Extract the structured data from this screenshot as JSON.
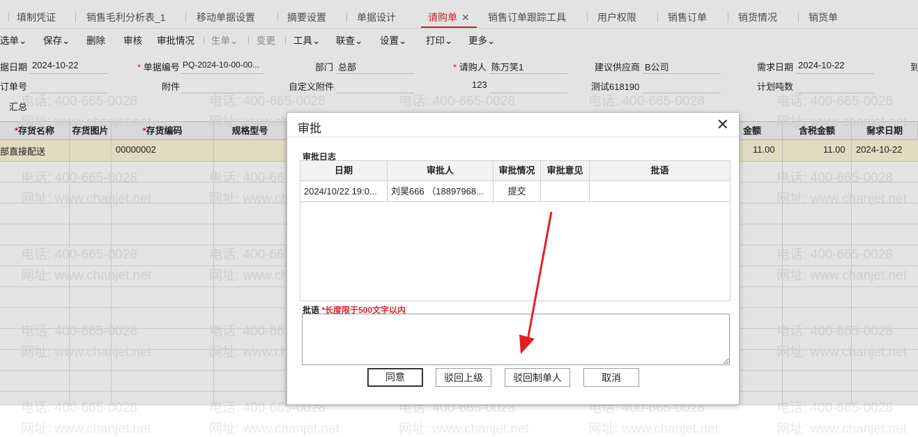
{
  "tabs": [
    "填制凭证",
    "销售毛利分析表_1",
    "移动单据设置",
    "摘要设置",
    "单据设计",
    "请购单",
    "销售订单跟踪工具",
    "用户权限",
    "销售订单",
    "销货情况",
    "销货单"
  ],
  "active_tab_close": "✕",
  "toolbar": {
    "select": "选单",
    "save": "保存",
    "delete": "删除",
    "audit": "审核",
    "audit_status": "审批情况",
    "generate": "生单",
    "change": "变更",
    "tools": "工具",
    "linked_query": "联查",
    "settings": "设置",
    "print": "打印",
    "more": "更多"
  },
  "form": {
    "doc_date_label": "据日期",
    "doc_date_value": "2024-10-22",
    "doc_no_label": "单据编号",
    "doc_no_value": "PQ-2024-10-00-00...",
    "dept_label": "部门",
    "dept_value": "总部",
    "requester_label": "请购人",
    "requester_value": "陈万笑1",
    "supplier_label": "建议供应商",
    "supplier_value": "B公司",
    "need_date_label": "需求日期",
    "need_date_value": "2024-10-22",
    "to_label": "到",
    "order_no_label": "订单号",
    "attach_label": "附件",
    "custom_attach_label": "自定义附件",
    "custom_value": "123",
    "test_label": "测试618190",
    "plan_ton_label": "计划吨数",
    "summary_label": "汇总",
    "required_mark": "*"
  },
  "grid": {
    "headers": [
      "存货名称",
      "存货图片",
      "存货编码",
      "规格型号",
      "金额",
      "含税金额",
      "需求日期"
    ],
    "row": {
      "name": "部直接配送",
      "code": "00000002",
      "amount": "11.00",
      "tax_amount": "11.00",
      "need_date": "2024-10-22"
    }
  },
  "watermark": {
    "phone": "电话: 400-665-0028",
    "site": "网址: www.chanjet.net"
  },
  "dialog": {
    "title": "审批",
    "close": "✕",
    "log_label": "审批日志",
    "log_headers": [
      "日期",
      "审批人",
      "审批情况",
      "审批意见",
      "批语"
    ],
    "log_rows": [
      {
        "date": "2024/10/22 19:0...",
        "approver": "刘昊666 （18897968...",
        "status": "提交",
        "opinion": "",
        "remark": ""
      }
    ],
    "remark_label": "批语",
    "remark_hint": "*长度限于500文字以内",
    "remark_value": "",
    "buttons": {
      "agree": "同意",
      "reject_up": "驳回上级",
      "reject_creator": "驳回制单人",
      "cancel": "取消"
    }
  },
  "colors": {
    "accent": "#d9272f",
    "row_highlight": "#fdf7d7",
    "arrow": "#e02020"
  }
}
